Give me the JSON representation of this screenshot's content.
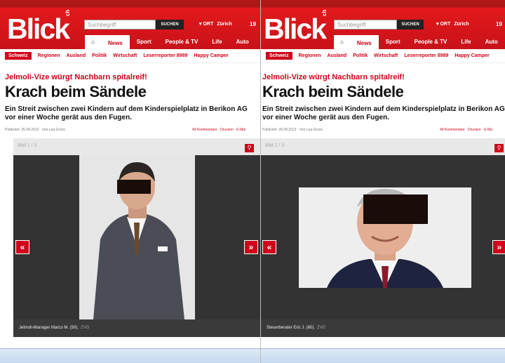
{
  "site": {
    "logo": "Blick",
    "logo_tld": "ch",
    "search_placeholder": "Suchbegriff",
    "search_button": "SUCHEN",
    "location_label": "ORT",
    "location_value": "Zürich",
    "temperature_partial_left": "19",
    "temperature_partial_right": "19",
    "nav": [
      "News",
      "Sport",
      "People & TV",
      "Life",
      "Auto"
    ],
    "subnav_left": [
      "Schweiz",
      "Regionen",
      "Ausland",
      "Politik",
      "Wirtschaft",
      "Leserreporter 8989",
      "Happy Camper"
    ],
    "subnav_right": [
      "Schweiz",
      "Regionen",
      "Ausland",
      "Politik",
      "Wirtschaft",
      "Leserreporter 8989",
      "Happy Camper"
    ]
  },
  "article": {
    "kicker": "Jelmoli-Vize würgt Nachbarn spitalreif!",
    "headline": "Krach beim Sändele",
    "lead_line1": "Ein Streit zwischen zwei Kindern auf dem Kinderspielplatz in Berikon AG",
    "lead_line2": "vor einer Woche gerät aus den Fugen.",
    "meta": "Publiziert: 26.08.2013 · Von Lea Gross",
    "actions_left": "49 Kommentare · Drucken · E-Mai",
    "actions_right": "49 Kommentare · Drucken · E-Ma"
  },
  "galleries": [
    {
      "counter": "Bild 1 / 3",
      "caption": "Jelmoli-Manager Marco M. (50).",
      "source": "ZVG"
    },
    {
      "counter": "Bild 2 / 3",
      "caption": "Steuerberater Eric J. (60).",
      "source": "ZVG"
    }
  ],
  "arrows": {
    "prev": "«",
    "next": "»"
  },
  "icons": {
    "zoom": "search-icon",
    "home": "home-icon"
  },
  "colors": {
    "brand_red": "#d0021b",
    "gallery_bg": "#333333"
  }
}
